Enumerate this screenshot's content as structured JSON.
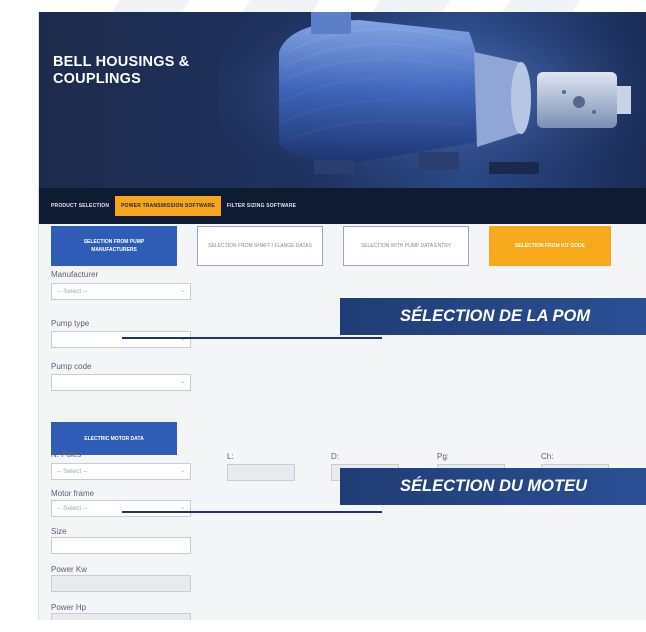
{
  "hero": {
    "title": "BELL HOUSINGS &\nCOUPLINGS"
  },
  "nav": {
    "items": [
      {
        "label": "PRODUCT SELECTION",
        "active": false
      },
      {
        "label": "POWER TRANSMISSION SOFTWARE",
        "active": true
      },
      {
        "label": "FILTER SIZING SOFTWARE",
        "active": false
      }
    ]
  },
  "methods": {
    "pump_manufacturer": "SELECTION FROM PUMP MANUFACTURERS",
    "shaft_flange": "SELECTION FROM SHAFT / FLANGE DATAS",
    "pump_data_entry": "SELECTION WITH PUMP DATA ENTRY",
    "kit_code": "SELECTION FROM KIT CODE"
  },
  "pump": {
    "manufacturer_label": "Manufacturer",
    "manufacturer_value": "-- Select --",
    "pump_type_label": "Pump type",
    "pump_code_label": "Pump code"
  },
  "motor": {
    "section_label": "ELECTRIC MOTOR DATA",
    "poles_label": "N. Poles",
    "poles_value": "-- Select --",
    "l_label": "L:",
    "d_label": "D:",
    "p_label": "Pg:",
    "c_label": "Ch:",
    "frame_label": "Motor frame",
    "frame_value": "-- Select --",
    "size_label": "Size",
    "power_kw_label": "Power Kw",
    "power_hp_label": "Power Hp"
  },
  "banners": {
    "pump": "SÉLECTION DE LA POM",
    "motor": "SÉLECTION DU MOTEU"
  },
  "colors": {
    "navy": "#1d2b4b",
    "primary_blue": "#2f5cb6",
    "orange": "#f7a81b",
    "banner_blue": "#203c75"
  }
}
